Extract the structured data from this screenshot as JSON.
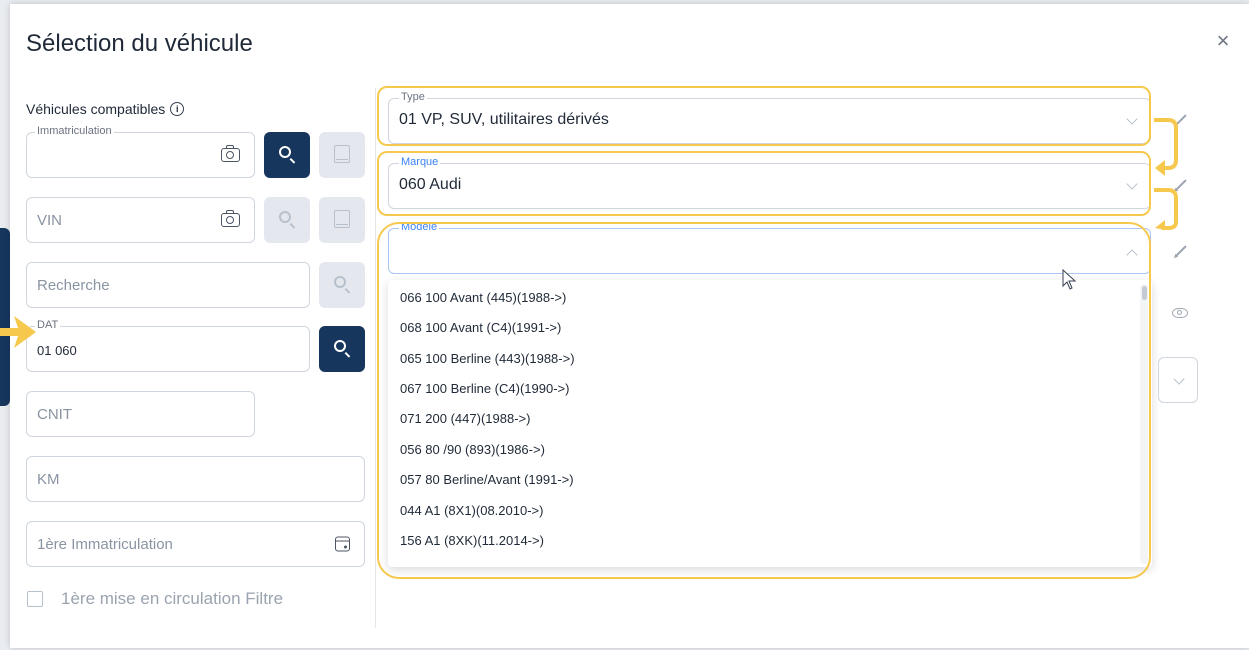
{
  "modal": {
    "title": "Sélection du véhicule",
    "close_label": "×"
  },
  "left": {
    "section_label": "Véhicules compatibles",
    "immatriculation": {
      "legend": "Immatriculation",
      "value": ""
    },
    "vin": {
      "placeholder": "VIN"
    },
    "recherche": {
      "placeholder": "Recherche"
    },
    "dat": {
      "legend": "DAT",
      "value": "01 060"
    },
    "cnit": {
      "placeholder": "CNIT"
    },
    "km": {
      "placeholder": "KM"
    },
    "first_registration": {
      "placeholder": "1ère Immatriculation"
    },
    "filter_checkbox_label": "1ère mise en circulation Filtre"
  },
  "right": {
    "type": {
      "legend": "Type",
      "value": "01 VP, SUV, utilitaires dérivés"
    },
    "marque": {
      "legend": "Marque",
      "value": "060 Audi"
    },
    "modele": {
      "legend": "Modèle",
      "value": ""
    },
    "modele_options": [
      "066 100 Avant (445)(1988->)",
      "068 100 Avant (C4)(1991->)",
      "065 100 Berline (443)(1988->)",
      "067 100 Berline (C4)(1990->)",
      "071 200 (447)(1988->)",
      "056 80 /90 (893)(1986->)",
      "057 80 Berline/Avant (1991->)",
      "044 A1 (8X1)(08.2010->)",
      "156 A1 (8XK)(11.2014->)"
    ]
  },
  "colors": {
    "primary": "#17365d",
    "highlight": "#f6c94e",
    "label_blue": "#3b82f6"
  }
}
